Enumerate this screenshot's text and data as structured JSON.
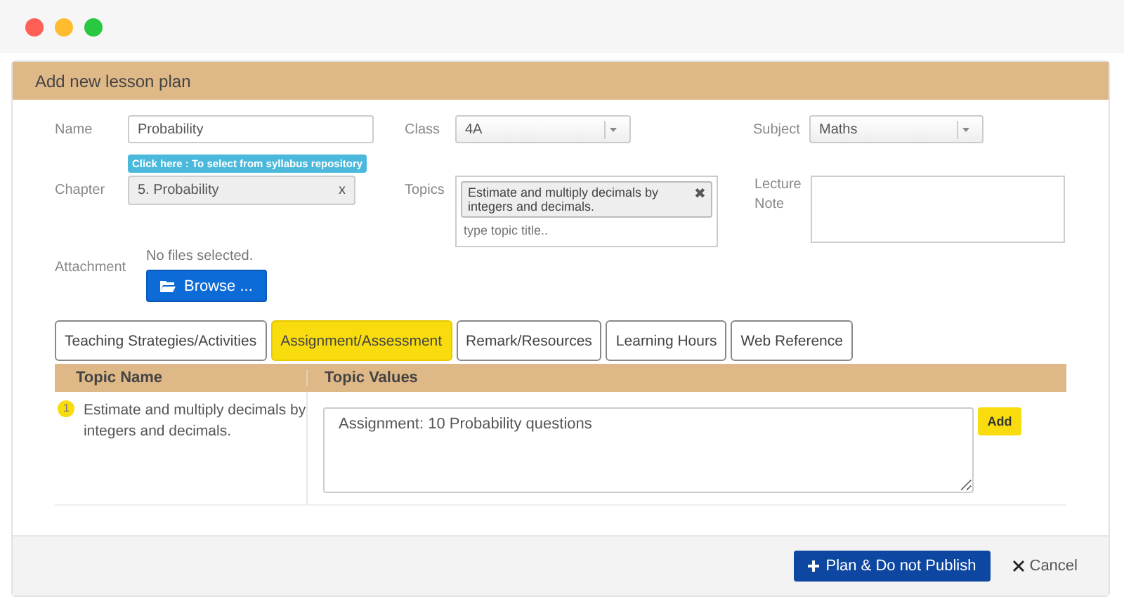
{
  "panel": {
    "title": "Add new lesson plan"
  },
  "form": {
    "name": {
      "label": "Name",
      "value": "Probability"
    },
    "class": {
      "label": "Class",
      "value": "4A"
    },
    "subject": {
      "label": "Subject",
      "value": "Maths"
    },
    "syllabus_link": "Click here : To select from syllabus repository",
    "chapter": {
      "label": "Chapter",
      "value": "5. Probability",
      "clear": "x"
    },
    "topics": {
      "label": "Topics",
      "tags": [
        {
          "text": "Estimate and multiply decimals by integers and decimals.",
          "remove": "✖"
        }
      ],
      "placeholder": "type topic title.."
    },
    "lecture_note": {
      "label": "Lecture Note"
    },
    "attachment": {
      "label": "Attachment",
      "status": "No files selected.",
      "button": "Browse ..."
    }
  },
  "tabs": [
    {
      "label": "Teaching Strategies/Activities",
      "selected": false
    },
    {
      "label": "Assignment/Assessment",
      "selected": true
    },
    {
      "label": "Remark/Resources",
      "selected": false
    },
    {
      "label": "Learning Hours",
      "selected": false
    },
    {
      "label": "Web Reference",
      "selected": false
    }
  ],
  "table": {
    "columns": [
      "Topic Name",
      "Topic Values"
    ],
    "rows": [
      {
        "index": "1",
        "topic": "Estimate and multiply decimals by integers and decimals.",
        "value": "Assignment: 10 Probability questions",
        "action": "Add"
      }
    ]
  },
  "footer": {
    "primary": "Plan & Do not Publish",
    "cancel": "Cancel"
  }
}
